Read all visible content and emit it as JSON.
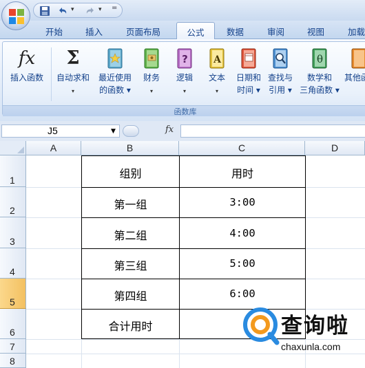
{
  "quick_access": {
    "save_icon": "save-icon",
    "undo_icon": "undo-icon",
    "redo_icon": "redo-icon",
    "more": "="
  },
  "tabs": [
    {
      "label": "开始"
    },
    {
      "label": "插入"
    },
    {
      "label": "页面布局"
    },
    {
      "label": "公式",
      "active": true
    },
    {
      "label": "数据"
    },
    {
      "label": "审阅"
    },
    {
      "label": "视图"
    },
    {
      "label": "加载"
    }
  ],
  "ribbon": {
    "group_label": "函数库",
    "buttons": [
      {
        "line1": "插入函数",
        "line2": "",
        "icon": "fx-icon"
      },
      {
        "line1": "自动求和",
        "line2": "▾",
        "icon": "sigma-icon"
      },
      {
        "line1": "最近使用",
        "line2": "的函数 ▾",
        "icon": "recent-functions-icon"
      },
      {
        "line1": "财务",
        "line2": "▾",
        "icon": "financial-icon"
      },
      {
        "line1": "逻辑",
        "line2": "▾",
        "icon": "logical-icon"
      },
      {
        "line1": "文本",
        "line2": "▾",
        "icon": "text-icon"
      },
      {
        "line1": "日期和",
        "line2": "时间 ▾",
        "icon": "date-time-icon"
      },
      {
        "line1": "查找与",
        "line2": "引用 ▾",
        "icon": "lookup-reference-icon"
      },
      {
        "line1": "数学和",
        "line2": "三角函数 ▾",
        "icon": "math-trig-icon"
      },
      {
        "line1": "其他函",
        "line2": "",
        "icon": "more-functions-icon"
      }
    ],
    "icon_glyphs": {
      "logical": "?",
      "text": "A",
      "math": "θ"
    }
  },
  "formula_bar": {
    "name_box": "J5",
    "fx_label": "fx",
    "formula": ""
  },
  "sheet": {
    "columns": [
      "A",
      "B",
      "C",
      "D"
    ],
    "rows": [
      "1",
      "2",
      "3",
      "4",
      "5",
      "6",
      "7",
      "8"
    ],
    "selected_row": "5",
    "table": {
      "headers": [
        "组别",
        "用时"
      ],
      "rows": [
        [
          "第一组",
          "3:00"
        ],
        [
          "第二组",
          "4:00"
        ],
        [
          "第三组",
          "5:00"
        ],
        [
          "第四组",
          "6:00"
        ],
        [
          "合计用时",
          ""
        ]
      ]
    }
  },
  "watermark": {
    "text": "查询啦",
    "url": "chaxunla.com"
  },
  "colors": {
    "accent_tab": "#15428b",
    "selected_row": "#f6c66e",
    "watermark_orange": "#f39a1e",
    "watermark_blue": "#2a8be0"
  }
}
